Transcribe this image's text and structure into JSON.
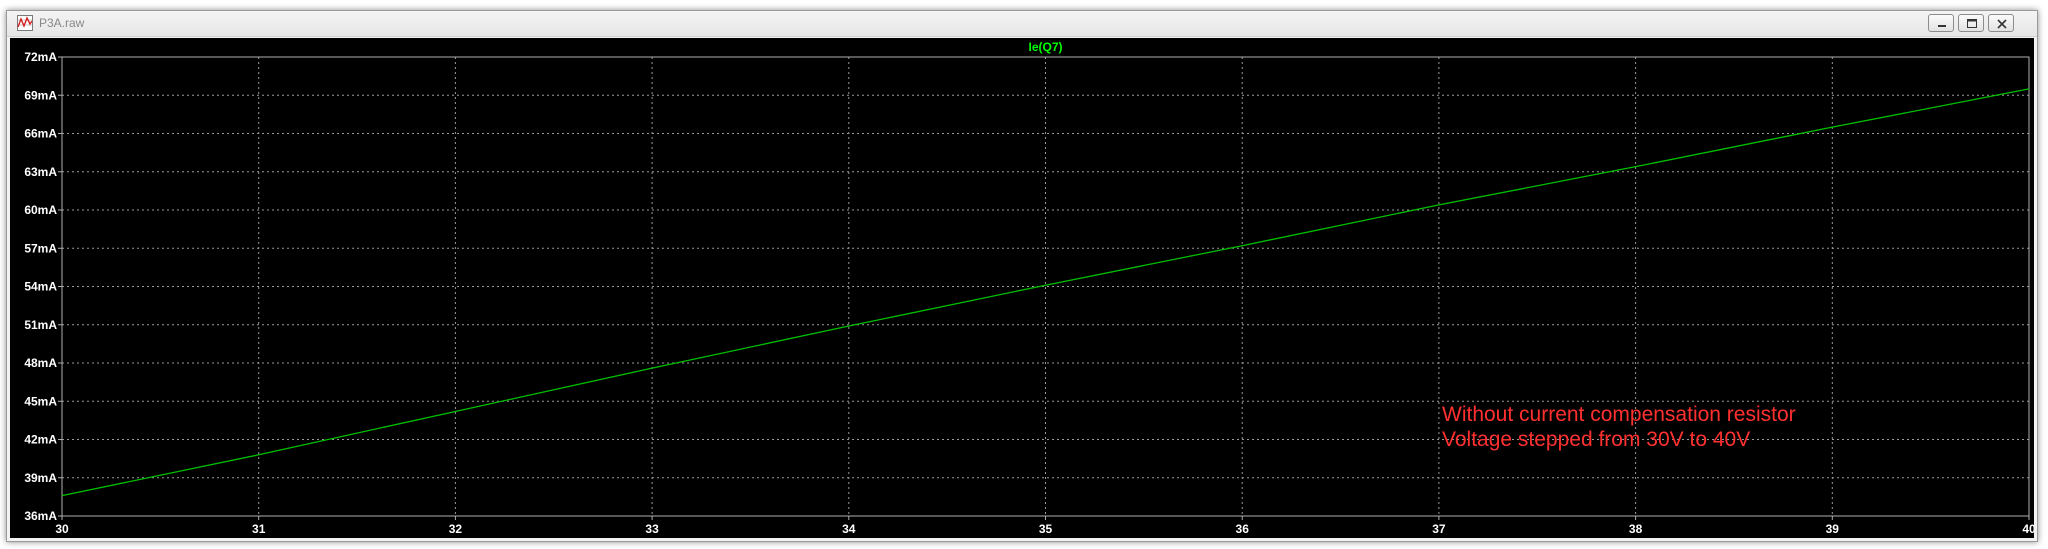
{
  "window": {
    "title": "P3A.raw",
    "icon": "waveform-viewer-icon",
    "controls": {
      "minimize": "minimize-icon",
      "maximize": "maximize-icon",
      "close": "close-icon"
    }
  },
  "colors": {
    "background": "#000000",
    "trace": "#00c000",
    "trace_label": "#00ff00",
    "annotation": "#ff3030",
    "axis_text": "#ffffff",
    "grid": "#9a9a9a"
  },
  "chart_data": {
    "type": "line",
    "title": "",
    "xlabel": "",
    "ylabel": "",
    "xlim": [
      30,
      40
    ],
    "ylim": [
      36,
      72
    ],
    "grid": true,
    "x_ticks": [
      30,
      31,
      32,
      33,
      34,
      35,
      36,
      37,
      38,
      39,
      40
    ],
    "x_tick_labels": [
      "30",
      "31",
      "32",
      "33",
      "34",
      "35",
      "36",
      "37",
      "38",
      "39",
      "40"
    ],
    "y_ticks": [
      36,
      39,
      42,
      45,
      48,
      51,
      54,
      57,
      60,
      63,
      66,
      69,
      72
    ],
    "y_tick_labels": [
      "36mA",
      "39mA",
      "42mA",
      "45mA",
      "48mA",
      "51mA",
      "54mA",
      "57mA",
      "60mA",
      "63mA",
      "66mA",
      "69mA",
      "72mA"
    ],
    "series": [
      {
        "name": "Ie(Q7)",
        "x": [
          30,
          31,
          32,
          33,
          34,
          35,
          36,
          37,
          38,
          39,
          40
        ],
        "y": [
          37.6,
          40.8,
          44.2,
          47.6,
          50.9,
          54.1,
          57.2,
          60.4,
          63.4,
          66.5,
          69.5
        ]
      }
    ],
    "annotations": [
      "Without current compensation resistor",
      "Voltage stepped from 30V to 40V"
    ]
  }
}
